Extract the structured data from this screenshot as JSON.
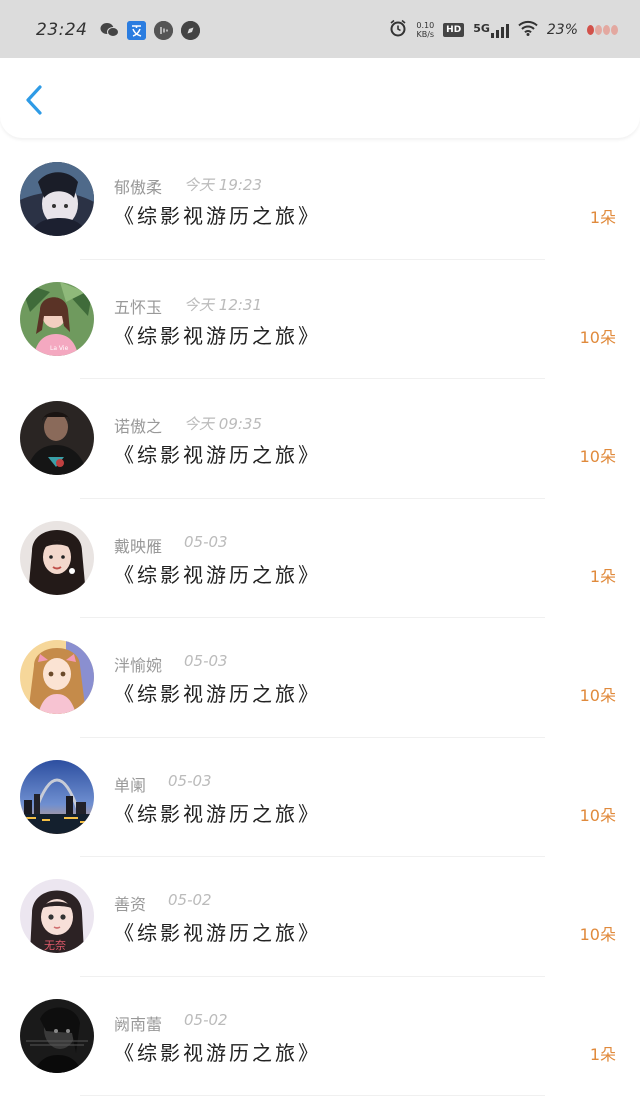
{
  "status_bar": {
    "time": "23:24",
    "net_speed_value": "0.10",
    "net_speed_unit": "KB/s",
    "hd": "HD",
    "network": "5G",
    "battery": "23%",
    "icons": [
      "wechat-icon",
      "translate-icon",
      "media-icon",
      "compass-icon",
      "alarm-icon",
      "signal-icon",
      "wifi-icon",
      "battery-icon"
    ]
  },
  "header": {
    "back_icon": "chevron-left-icon",
    "accent": "#2e9be6"
  },
  "colors": {
    "flower_count": "#e08a3c",
    "name": "#999999",
    "time": "#bbbbbb"
  },
  "items": [
    {
      "name": "郁傲柔",
      "time": "今天 19:23",
      "title": "《综影视游历之旅》",
      "flowers": "1朵"
    },
    {
      "name": "五怀玉",
      "time": "今天 12:31",
      "title": "《综影视游历之旅》",
      "flowers": "10朵"
    },
    {
      "name": "诺傲之",
      "time": "今天 09:35",
      "title": "《综影视游历之旅》",
      "flowers": "10朵"
    },
    {
      "name": "戴映雁",
      "time": "05-03",
      "title": "《综影视游历之旅》",
      "flowers": "1朵"
    },
    {
      "name": "泮愉婉",
      "time": "05-03",
      "title": "《综影视游历之旅》",
      "flowers": "10朵"
    },
    {
      "name": "单阑",
      "time": "05-03",
      "title": "《综影视游历之旅》",
      "flowers": "10朵"
    },
    {
      "name": "善资",
      "time": "05-02",
      "title": "《综影视游历之旅》",
      "flowers": "10朵"
    },
    {
      "name": "阙南蕾",
      "time": "05-02",
      "title": "《综影视游历之旅》",
      "flowers": "1朵"
    }
  ],
  "avatar_text": {
    "item7": "无奈"
  }
}
